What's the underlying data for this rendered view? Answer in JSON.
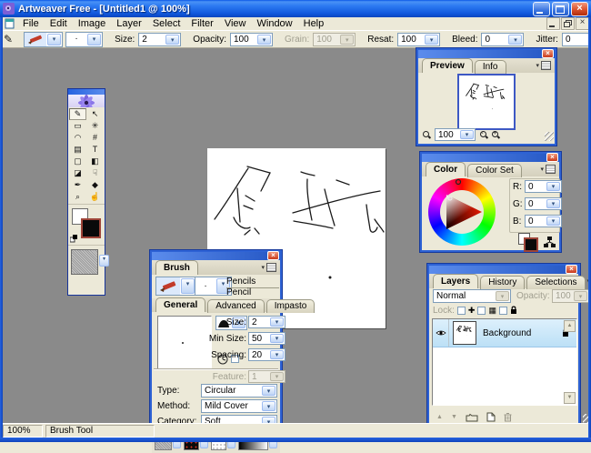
{
  "colors": {
    "titlebar_blue": "#2A66D9",
    "panel_border_blue": "#2E62D4",
    "workspace_gray": "#8A8A8A",
    "close_red": "#C93A1C",
    "selection_blue": "#CBE4F7"
  },
  "icons": {
    "dropdown": "▾",
    "close": "×",
    "scroll_up": "▲",
    "scroll_down": "▼",
    "layer_up": "▲",
    "layer_down": "▼"
  },
  "titlebar": {
    "title": "Artweaver Free - [Untitled1 @ 100%]"
  },
  "menu": {
    "items": [
      "File",
      "Edit",
      "Image",
      "Layer",
      "Select",
      "Filter",
      "View",
      "Window",
      "Help"
    ]
  },
  "options_bar": {
    "fields": [
      {
        "label": "Size:",
        "value": "2"
      },
      {
        "label": "Opacity:",
        "value": "100"
      },
      {
        "label": "Grain:",
        "value": "100"
      },
      {
        "label": "Resat:",
        "value": "100"
      },
      {
        "label": "Bleed:",
        "value": "0"
      },
      {
        "label": "Jitter:",
        "value": "0"
      }
    ]
  },
  "toolbox": {
    "tools": [
      {
        "name": "brush",
        "glyph": "✎"
      },
      {
        "name": "move",
        "glyph": "↖"
      },
      {
        "name": "marquee",
        "glyph": "▭"
      },
      {
        "name": "magic-wand",
        "glyph": "✳"
      },
      {
        "name": "lasso",
        "glyph": "◠"
      },
      {
        "name": "crop",
        "glyph": "#"
      },
      {
        "name": "stamp",
        "glyph": "▤"
      },
      {
        "name": "text",
        "glyph": "T"
      },
      {
        "name": "shape",
        "glyph": "▢"
      },
      {
        "name": "gradient",
        "glyph": "◧"
      },
      {
        "name": "eraser",
        "glyph": "◪"
      },
      {
        "name": "smudge",
        "glyph": "☟"
      },
      {
        "name": "eyedropper",
        "glyph": "✒"
      },
      {
        "name": "fill",
        "glyph": "◆"
      },
      {
        "name": "zoom",
        "glyph": "⌕"
      },
      {
        "name": "hand",
        "glyph": "☝"
      }
    ]
  },
  "canvas": {
    "description": "Hand-drawn Chinese characters 领航 sketched with the pencil brush"
  },
  "preview_panel": {
    "tabs": [
      "Preview",
      "Info"
    ],
    "zoom_value": "100"
  },
  "color_panel": {
    "tabs": [
      "Color",
      "Color Set"
    ],
    "channels": [
      {
        "label": "R:",
        "value": "0"
      },
      {
        "label": "G:",
        "value": "0"
      },
      {
        "label": "B:",
        "value": "0"
      }
    ]
  },
  "brush_panel": {
    "tab": "Brush",
    "category": "Pencils",
    "preset": "Pencil",
    "tabs": [
      "General",
      "Advanced",
      "Impasto"
    ],
    "fields": [
      {
        "label": "Size:",
        "value": "2"
      },
      {
        "label": "Min Size:",
        "value": "50"
      },
      {
        "label": "Spacing:",
        "value": "20"
      },
      {
        "label": "Feature:",
        "value": "1"
      }
    ],
    "selects": [
      {
        "label": "Type:",
        "value": "Circular"
      },
      {
        "label": "Method:",
        "value": "Mild Cover"
      },
      {
        "label": "Category:",
        "value": "Soft"
      }
    ]
  },
  "layers_panel": {
    "tabs": [
      "Layers",
      "History",
      "Selections"
    ],
    "blend_mode": "Normal",
    "opacity_label": "Opacity:",
    "opacity_value": "100",
    "lock_label": "Lock:",
    "layers": [
      {
        "name": "Background"
      }
    ]
  },
  "status_bar": {
    "zoom": "100%",
    "tool": "Brush Tool"
  }
}
